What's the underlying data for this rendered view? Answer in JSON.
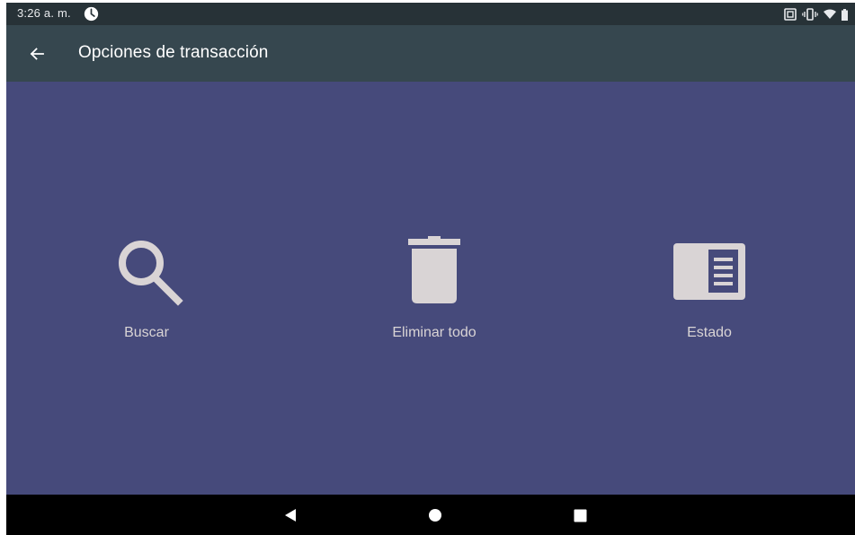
{
  "status_bar": {
    "time": "3:26 a. m.",
    "icons": [
      "clock-icon",
      "nfc-icon",
      "vibrate-icon",
      "wifi-icon",
      "battery-icon"
    ]
  },
  "app_bar": {
    "title": "Opciones de transacción",
    "back_icon": "arrow-back-icon"
  },
  "options": [
    {
      "label": "Buscar",
      "icon": "search-icon"
    },
    {
      "label": "Eliminar todo",
      "icon": "trash-icon"
    },
    {
      "label": "Estado",
      "icon": "receipt-icon"
    }
  ],
  "nav_bar": {
    "buttons": [
      "nav-back-icon",
      "nav-home-icon",
      "nav-recents-icon"
    ]
  },
  "colors": {
    "background": "#464a7b",
    "app_bar": "#36474f",
    "status_bar": "#273237",
    "icon_color": "#d9d4d5",
    "nav_bar": "#000000"
  }
}
